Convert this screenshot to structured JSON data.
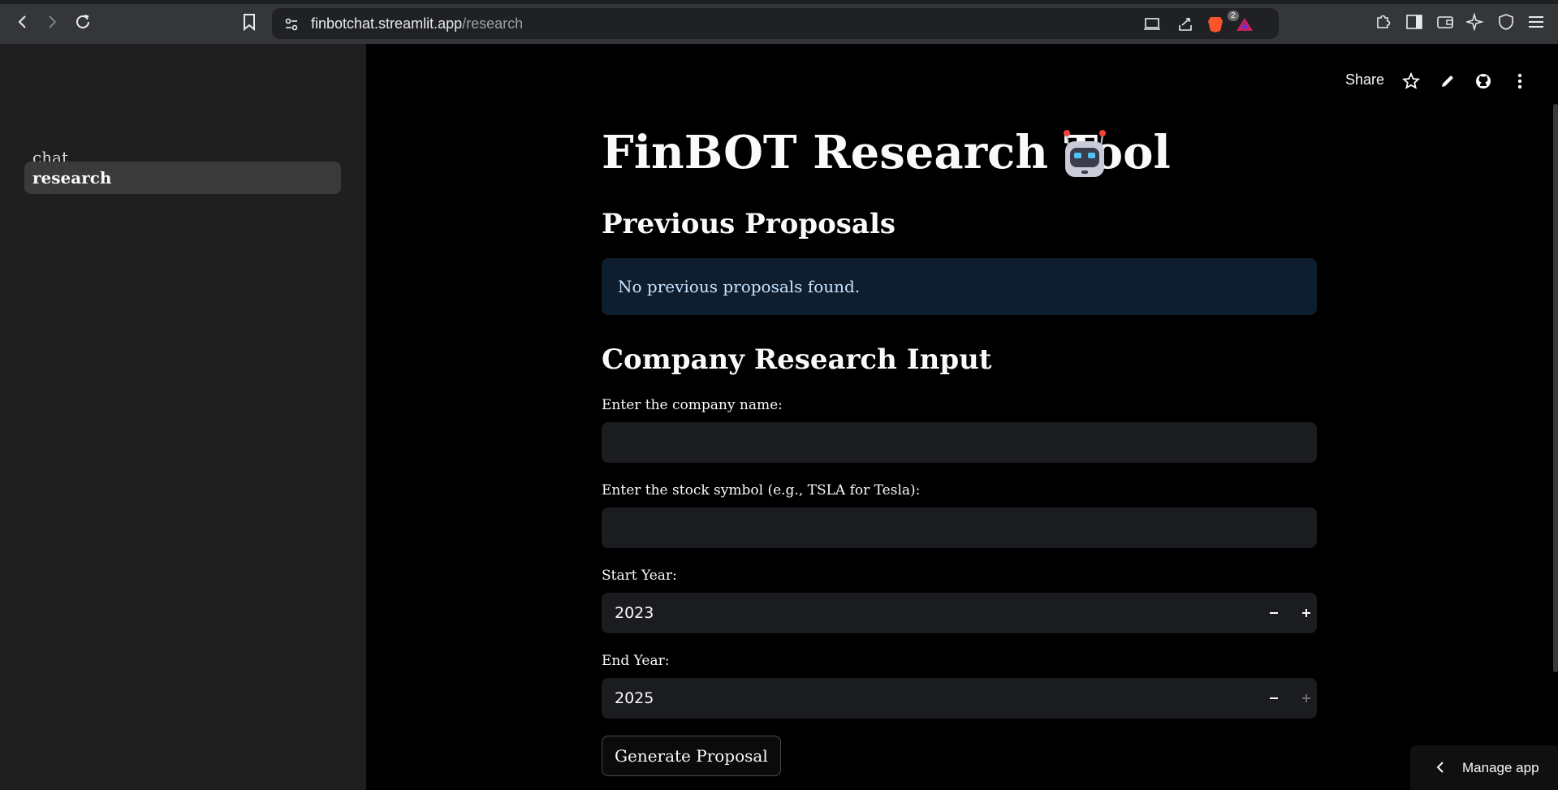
{
  "browser": {
    "url_host": "finbotchat.streamlit.app",
    "url_path": "/research",
    "extension_badge": "2"
  },
  "sidebar": {
    "items": [
      {
        "label": "chat"
      },
      {
        "label": "research"
      }
    ]
  },
  "toolbar": {
    "share_label": "Share"
  },
  "main": {
    "title": "FinBOT Research Tool",
    "previous_heading": "Previous Proposals",
    "info_message": "No previous proposals found.",
    "input_heading": "Company Research Input",
    "company_label": "Enter the company name:",
    "company_value": "",
    "symbol_label": "Enter the stock symbol (e.g., TSLA for Tesla):",
    "symbol_value": "",
    "start_label": "Start Year:",
    "start_value": "2023",
    "end_label": "End Year:",
    "end_value": "2025",
    "generate_label": "Generate Proposal"
  },
  "manage": {
    "label": "Manage app"
  },
  "colors": {
    "background": "#000000",
    "sidebar": "#1f1f1f",
    "info_bg": "#0f1e2e",
    "info_text": "#c7e3ff",
    "input_bg": "#1b1c1f"
  },
  "icons": {
    "back": "chevron-left-icon",
    "forward": "chevron-right-icon",
    "reload": "reload-icon",
    "bookmark": "bookmark-icon",
    "site_settings": "tune-icon",
    "star": "star-icon",
    "edit": "pencil-icon",
    "github": "github-icon",
    "more": "more-vertical-icon",
    "robot": "robot-icon"
  }
}
